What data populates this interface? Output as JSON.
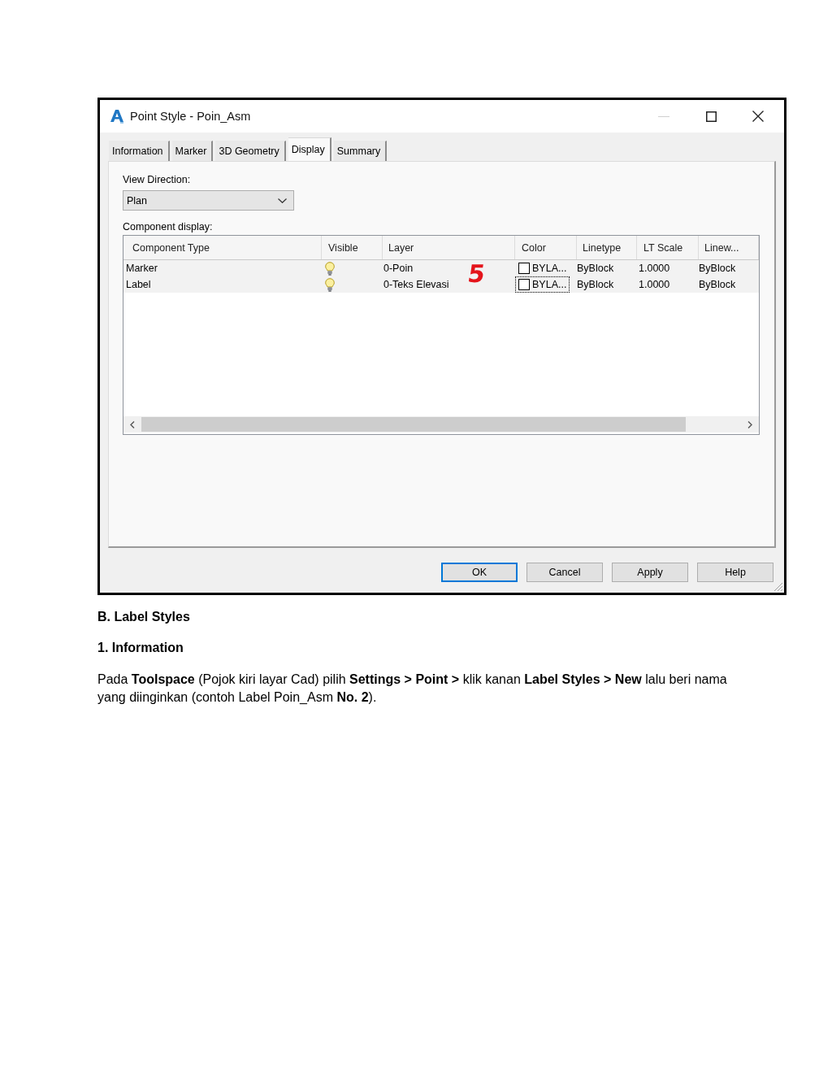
{
  "window": {
    "title": "Point Style - Poin_Asm",
    "controls": [
      {
        "kind": "minimize",
        "disabled": true
      },
      {
        "kind": "maximize",
        "disabled": false
      },
      {
        "kind": "close",
        "disabled": false
      }
    ]
  },
  "tabs": [
    {
      "label": "Information",
      "selected": false
    },
    {
      "label": "Marker",
      "selected": false
    },
    {
      "label": "3D Geometry",
      "selected": false
    },
    {
      "label": "Display",
      "selected": true
    },
    {
      "label": "Summary",
      "selected": false
    }
  ],
  "view_direction": {
    "label": "View Direction:",
    "value": "Plan"
  },
  "component_display": {
    "label": "Component display:",
    "columns": [
      "Component Type",
      "Visible",
      "Layer",
      "Color",
      "Linetype",
      "LT Scale",
      "Linew..."
    ],
    "rows": [
      {
        "component_type": "Marker",
        "visible": true,
        "layer": "0-Poin",
        "color_name": "BYLA...",
        "color_focused": false,
        "linetype": "ByBlock",
        "lt_scale": "1.0000",
        "column_7": "ByBlock"
      },
      {
        "component_type": "Label",
        "visible": true,
        "layer": "0-Teks Elevasi",
        "color_name": "BYLA...",
        "color_focused": true,
        "linetype": "ByBlock",
        "lt_scale": "1.0000",
        "column_7": "ByBlock"
      }
    ],
    "annotation": "5"
  },
  "buttons": [
    {
      "label": "OK",
      "default": true
    },
    {
      "label": "Cancel",
      "default": false
    },
    {
      "label": "Apply",
      "default": false
    },
    {
      "label": "Help",
      "default": false
    }
  ],
  "document": {
    "heading": "B. Label Styles",
    "subheading": "1. Information",
    "paragraph": "Pada **Toolspace** (Pojok kiri layar Cad) pilih **Settings > Point >** klik kanan **Label Styles > New** lalu beri nama yang diinginkan (contoh Label Poin_Asm **No. 2**)."
  }
}
